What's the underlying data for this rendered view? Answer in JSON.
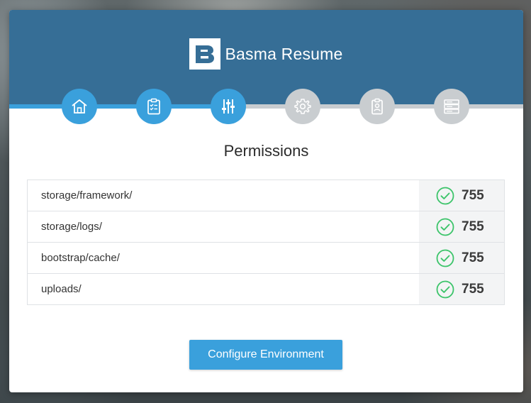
{
  "brand": {
    "name": "Basma Resume",
    "logo_letter": "B",
    "color": "#366e96",
    "accent": "#3aa0dc"
  },
  "stepper": {
    "steps": [
      {
        "icon": "home-icon",
        "state": "done"
      },
      {
        "icon": "clipboard-checklist-icon",
        "state": "done"
      },
      {
        "icon": "sliders-icon",
        "state": "done"
      },
      {
        "icon": "gear-icon",
        "state": "todo"
      },
      {
        "icon": "id-badge-icon",
        "state": "todo"
      },
      {
        "icon": "server-icon",
        "state": "todo"
      }
    ]
  },
  "page": {
    "title": "Permissions"
  },
  "permissions": [
    {
      "path": "storage/framework/",
      "value": "755",
      "status": "ok"
    },
    {
      "path": "storage/logs/",
      "value": "755",
      "status": "ok"
    },
    {
      "path": "bootstrap/cache/",
      "value": "755",
      "status": "ok"
    },
    {
      "path": "uploads/",
      "value": "755",
      "status": "ok"
    }
  ],
  "actions": {
    "next_label": "Configure Environment"
  },
  "colors": {
    "success": "#3cc46a",
    "step_done": "#3aa0dc",
    "step_todo": "#c9cdd0"
  }
}
